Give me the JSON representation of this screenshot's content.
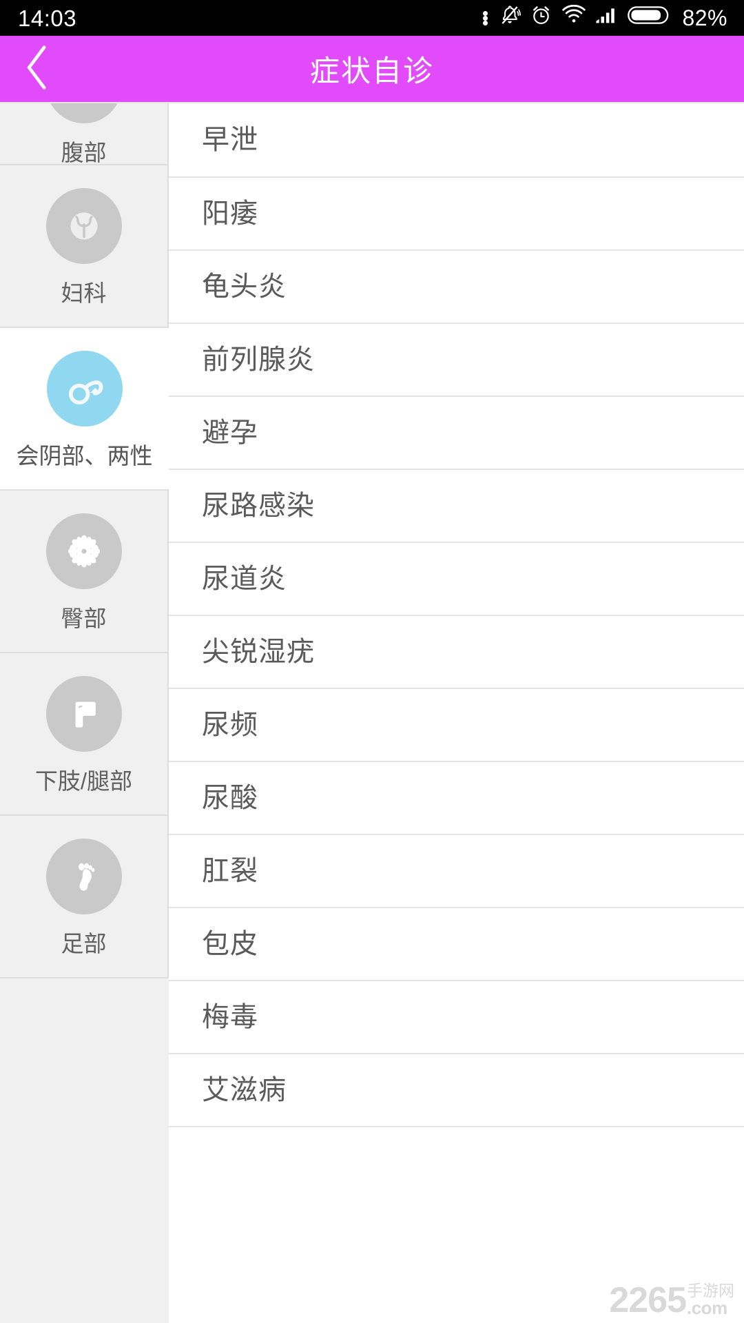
{
  "status_bar": {
    "time": "14:03",
    "battery_percent": "82%",
    "icons": [
      "more-dots-icon",
      "bell-muted-icon",
      "alarm-clock-icon",
      "wifi-icon",
      "cellular-signal-icon",
      "battery-icon"
    ]
  },
  "header": {
    "title": "症状自诊",
    "back_icon": "chevron-left-icon",
    "background_color": "#e24bfb",
    "text_color": "#ffffff"
  },
  "sidebar": {
    "active_index": 2,
    "active_icon_color": "#90d7f0",
    "inactive_icon_color": "#c9c9c9",
    "items": [
      {
        "label": "腹部",
        "icon": "stomach-icon",
        "partial": true
      },
      {
        "label": "妇科",
        "icon": "uterus-icon",
        "partial": false
      },
      {
        "label": "会阴部、两性",
        "icon": "male-gender-icon",
        "partial": false
      },
      {
        "label": "臀部",
        "icon": "flower-anus-icon",
        "partial": false
      },
      {
        "label": "下肢/腿部",
        "icon": "leg-icon",
        "partial": false
      },
      {
        "label": "足部",
        "icon": "footprint-icon",
        "partial": false
      }
    ]
  },
  "list": {
    "items": [
      {
        "label": "早泄"
      },
      {
        "label": "阳痿"
      },
      {
        "label": "龟头炎"
      },
      {
        "label": "前列腺炎"
      },
      {
        "label": "避孕"
      },
      {
        "label": "尿路感染"
      },
      {
        "label": "尿道炎"
      },
      {
        "label": "尖锐湿疣"
      },
      {
        "label": "尿频"
      },
      {
        "label": "尿酸"
      },
      {
        "label": "肛裂"
      },
      {
        "label": "包皮"
      },
      {
        "label": "梅毒"
      },
      {
        "label": "艾滋病"
      }
    ]
  },
  "watermark": {
    "number": "2265",
    "cn": "手游网",
    "domain": ".com"
  }
}
